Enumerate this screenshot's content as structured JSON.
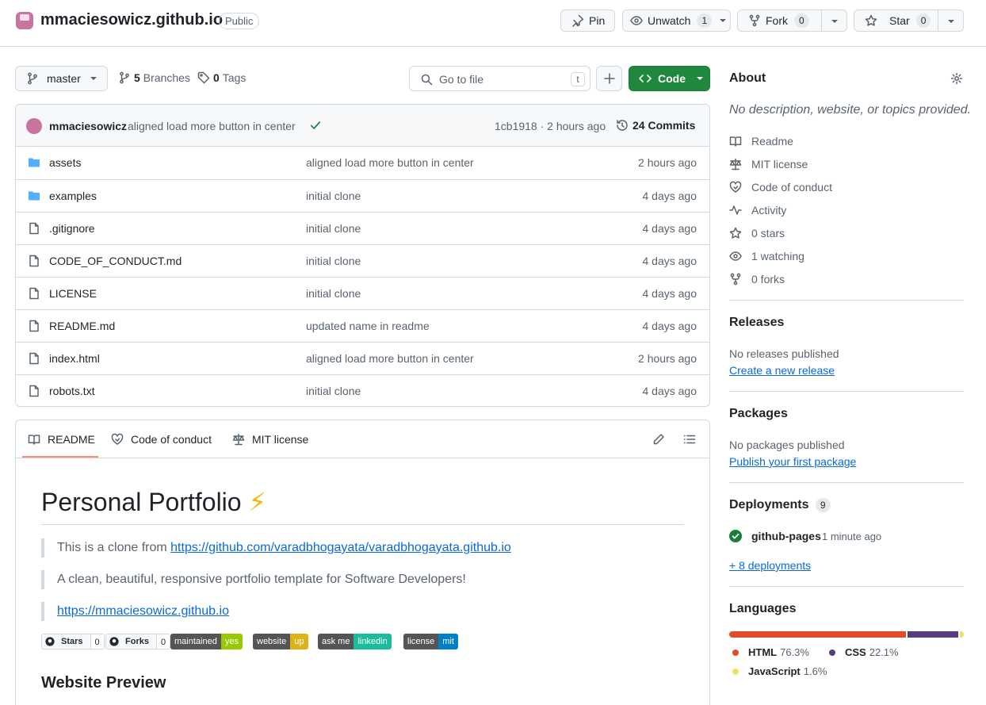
{
  "header": {
    "repo_name": "mmaciesowicz.github.io",
    "visibility": "Public",
    "pin_label": "Pin",
    "unwatch_label": "Unwatch",
    "watch_count": "1",
    "fork_label": "Fork",
    "fork_count": "0",
    "star_label": "Star",
    "star_count": "0"
  },
  "toolbar": {
    "branch": "master",
    "branches_count": "5",
    "branches_label": "Branches",
    "tags_count": "0",
    "tags_label": "Tags",
    "search_placeholder": "Go to file",
    "search_shortcut": "t",
    "code_label": "Code"
  },
  "latest_commit": {
    "author": "mmaciesowicz",
    "message": "aligned load more button in center",
    "hash_time": "1cb1918 · 2 hours ago",
    "commits_count": "24",
    "commits_label": "Commits"
  },
  "files": [
    {
      "name": "assets",
      "type": "folder",
      "message": "aligned load more button in center",
      "age": "2 hours ago"
    },
    {
      "name": "examples",
      "type": "folder",
      "message": "initial clone",
      "age": "4 days ago"
    },
    {
      "name": ".gitignore",
      "type": "file",
      "message": "initial clone",
      "age": "4 days ago"
    },
    {
      "name": "CODE_OF_CONDUCT.md",
      "type": "file",
      "message": "initial clone",
      "age": "4 days ago"
    },
    {
      "name": "LICENSE",
      "type": "file",
      "message": "initial clone",
      "age": "4 days ago"
    },
    {
      "name": "README.md",
      "type": "file",
      "message": "updated name in readme",
      "age": "4 days ago"
    },
    {
      "name": "index.html",
      "type": "file",
      "message": "aligned load more button in center",
      "age": "2 hours ago"
    },
    {
      "name": "robots.txt",
      "type": "file",
      "message": "initial clone",
      "age": "4 days ago"
    }
  ],
  "readme": {
    "tabs": [
      "README",
      "Code of conduct",
      "MIT license"
    ],
    "title": "Personal Portfolio",
    "title_emoji": "⚡",
    "quote1_prefix": "This is a clone from ",
    "quote1_link": "https://github.com/varadbhogayata/varadbhogayata.github.io",
    "quote2": "A clean, beautiful, responsive portfolio template for Software Developers!",
    "quote3_link": "https://mmaciesowicz.github.io",
    "badges": [
      {
        "left": "Stars",
        "right": "0",
        "kind": "github"
      },
      {
        "left": "Forks",
        "right": "0",
        "kind": "github"
      },
      {
        "left": "maintained",
        "right": "yes",
        "color": "#97ca00"
      },
      {
        "left": "website",
        "right": "up",
        "color": "#dfb317"
      },
      {
        "left": "ask me",
        "right": "linkedin",
        "color": "#1bbc9b"
      },
      {
        "left": "license",
        "right": "mit",
        "color": "#007ec6"
      }
    ],
    "section_heading": "Website Preview"
  },
  "sidebar": {
    "about_heading": "About",
    "description": "No description, website, or topics provided.",
    "links": [
      {
        "label": "Readme",
        "icon": "book-icon"
      },
      {
        "label": "MIT license",
        "icon": "law-icon"
      },
      {
        "label": "Code of conduct",
        "icon": "code-of-conduct-icon"
      },
      {
        "label": "Activity",
        "icon": "pulse-icon"
      },
      {
        "label": "0 stars",
        "icon": "star-icon"
      },
      {
        "label": "1 watching",
        "icon": "eye-icon"
      },
      {
        "label": "0 forks",
        "icon": "fork-icon"
      }
    ],
    "releases_heading": "Releases",
    "releases_text": "No releases published",
    "releases_link": "Create a new release",
    "packages_heading": "Packages",
    "packages_text": "No packages published",
    "packages_link": "Publish your first package",
    "deployments_heading": "Deployments",
    "deployments_count": "9",
    "deployment_name": "github-pages",
    "deployment_time": "1 minute ago",
    "more_deployments": "+ 8 deployments",
    "languages_heading": "Languages",
    "languages": [
      {
        "name": "HTML",
        "percent": "76.3%",
        "value": 76.3,
        "color": "#e34c26"
      },
      {
        "name": "CSS",
        "percent": "22.1%",
        "value": 22.1,
        "color": "#563d7c"
      },
      {
        "name": "JavaScript",
        "percent": "1.6%",
        "value": 1.6,
        "color": "#f1e05a"
      }
    ]
  }
}
